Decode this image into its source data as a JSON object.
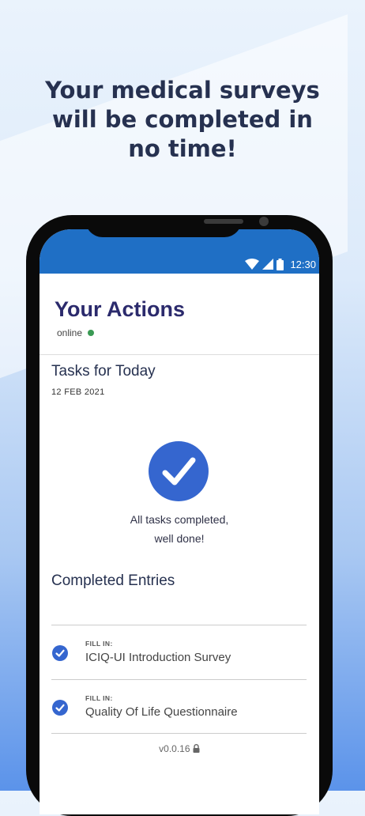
{
  "headline": {
    "line1": "Your medical surveys",
    "line2": "will be completed in",
    "line3": "no time!"
  },
  "status_bar": {
    "time": "12:30",
    "icons": [
      "wifi-icon",
      "signal-icon",
      "battery-icon"
    ]
  },
  "header": {
    "title": "Your Actions",
    "status": "online",
    "status_color": "#3a9a54"
  },
  "tasks": {
    "title": "Tasks for Today",
    "date": "12 FEB 2021",
    "done_line1": "All tasks completed,",
    "done_line2": "well done!"
  },
  "completed": {
    "title": "Completed Entries",
    "entries": [
      {
        "kicker": "FILL IN:",
        "title": "ICIQ-UI Introduction Survey"
      },
      {
        "kicker": "FILL IN:",
        "title": "Quality Of Life Questionnaire"
      }
    ]
  },
  "footer": {
    "version": "v0.0.16"
  },
  "colors": {
    "accent": "#3566cf",
    "statusbar": "#1f6fc5",
    "title": "#2b2a6c"
  }
}
